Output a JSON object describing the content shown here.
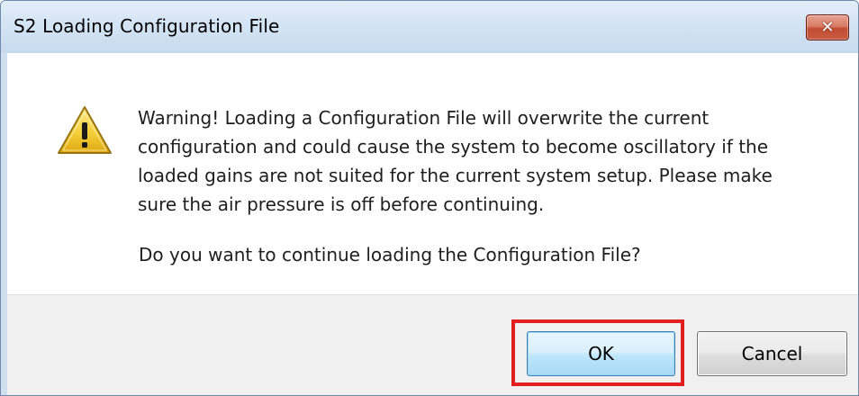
{
  "window": {
    "title": "S2 Loading Configuration File",
    "close_icon": "close-icon"
  },
  "message": {
    "icon": "warning-icon",
    "lines": [
      "Warning! Loading a Configuration File will overwrite the current",
      "configuration and could cause the system to become oscillatory if the",
      "loaded gains are not suited for the current system setup. Please make",
      "sure the air pressure is off before continuing."
    ],
    "question": "Do you want to continue loading the Configuration File?"
  },
  "buttons": {
    "ok_label": "OK",
    "cancel_label": "Cancel"
  },
  "colors": {
    "highlight": "#e21e1e",
    "warning_fill": "#f4d03a",
    "titlebar": "#d4e4f5",
    "close_button": "#c85c42"
  }
}
